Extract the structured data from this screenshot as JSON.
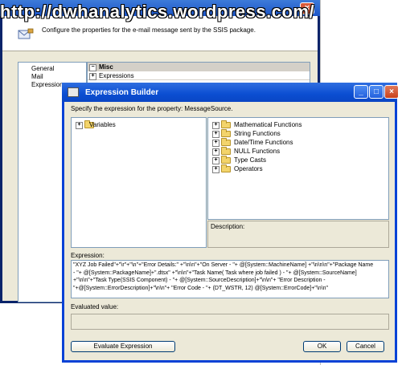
{
  "watermark": "http://dwhanalytics.wordpress.com/",
  "background_window": {
    "close_glyph": "×",
    "header_text": "Configure the properties for the e-mail message sent by the SSIS package.",
    "nav_items": [
      "General",
      "Mail",
      "Expressions"
    ],
    "grid_category": "Misc",
    "grid_row": "Expressions",
    "category_toggle": "−",
    "row_toggle": "+"
  },
  "dialog": {
    "title": "Expression Builder",
    "title_buttons": {
      "minimize": "_",
      "maximize": "□",
      "close": "×"
    },
    "prompt": "Specify the expression for the property: MessageSource.",
    "variables_label": "Variables",
    "functions": [
      "Mathematical Functions",
      "String Functions",
      "Date/Time Functions",
      "NULL Functions",
      "Type Casts",
      "Operators"
    ],
    "expand_glyph": "+",
    "description_label": "Description:",
    "expression_label": "Expression:",
    "expression_lines": [
      "\"XYZ Job Failed\"+\"\\r\"+\"\\n\"+\"Error Details:\" +\"\\n\\n\"+\"On Server - \"+ @[System::MachineName] +\"\\n\\n\\n\"+\"Package Name",
      "- \"+ @[System::PackageName]+\".dtsx\" +\"\\n\\n\"+\"Task Name( Task where job failed ) - \"+ @[System::SourceName]",
      "+\"\\n\\n\"+\"Task Type(SSIS Component) - \"+ @[System::SourceDescription]+\"\\n\\n\"+ \"Error Description -",
      "\"+@[System::ErrorDescription]+\"\\n\\n\"+ \"Error Code - \"+ (DT_WSTR, 12) @[System::ErrorCode]+\"\\n\\n\""
    ],
    "evaluated_label": "Evaluated value:",
    "evaluated_value": "",
    "evaluate_button": "Evaluate Expression",
    "ok_button": "OK",
    "cancel_button": "Cancel"
  }
}
